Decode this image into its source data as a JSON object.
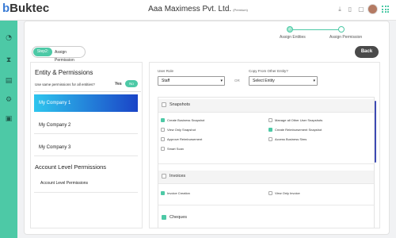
{
  "header": {
    "logo_b": "b",
    "logo_text": "Buktec",
    "company": "Aaa Maximess Pvt. Ltd.",
    "company_tag": "(Premium)"
  },
  "steps": [
    {
      "label": "Assign Entities"
    },
    {
      "label": "Assign Permission"
    }
  ],
  "step_tabs": {
    "active": "Step2:",
    "label": "Assign Permission"
  },
  "back_label": "Back",
  "left": {
    "title": "Entity & Permissions",
    "question": "Use same permissions for all entities?",
    "yes": "Yes",
    "no": "No",
    "entities": [
      "My Company 1",
      "My Company 2",
      "My Company 3"
    ],
    "account_title": "Account Level Permissions",
    "account_item": "Account Level Permissions"
  },
  "right": {
    "user_role_label": "User Role",
    "user_role_value": "Staff",
    "or": "OR",
    "copy_label": "Copy From Other Entity?",
    "copy_value": "Select Entity",
    "sections": {
      "snapshots": "Snapshots",
      "invoices": "Invoices",
      "cheques": "Cheques"
    },
    "snapshot_opts": [
      {
        "label": "Create Business Snapshot",
        "checked": true
      },
      {
        "label": "Manage all Other User Snapshots",
        "checked": false
      },
      {
        "label": "View Only Snapshot",
        "checked": false
      },
      {
        "label": "Create Reimbursement Snapshot",
        "checked": true
      },
      {
        "label": "Approve Reimbursement",
        "checked": false
      },
      {
        "label": "Access Business Sims",
        "checked": false
      },
      {
        "label": "Smart Scan",
        "checked": false
      }
    ],
    "invoice_opts": [
      {
        "label": "Invoice Creation",
        "checked": true
      },
      {
        "label": "View Only Invoice",
        "checked": false
      }
    ]
  },
  "colors": {
    "accent": "#4dc9a6",
    "active_from": "#2ec5ee",
    "active_to": "#1a44c7",
    "dark": "#4a4a4a"
  }
}
